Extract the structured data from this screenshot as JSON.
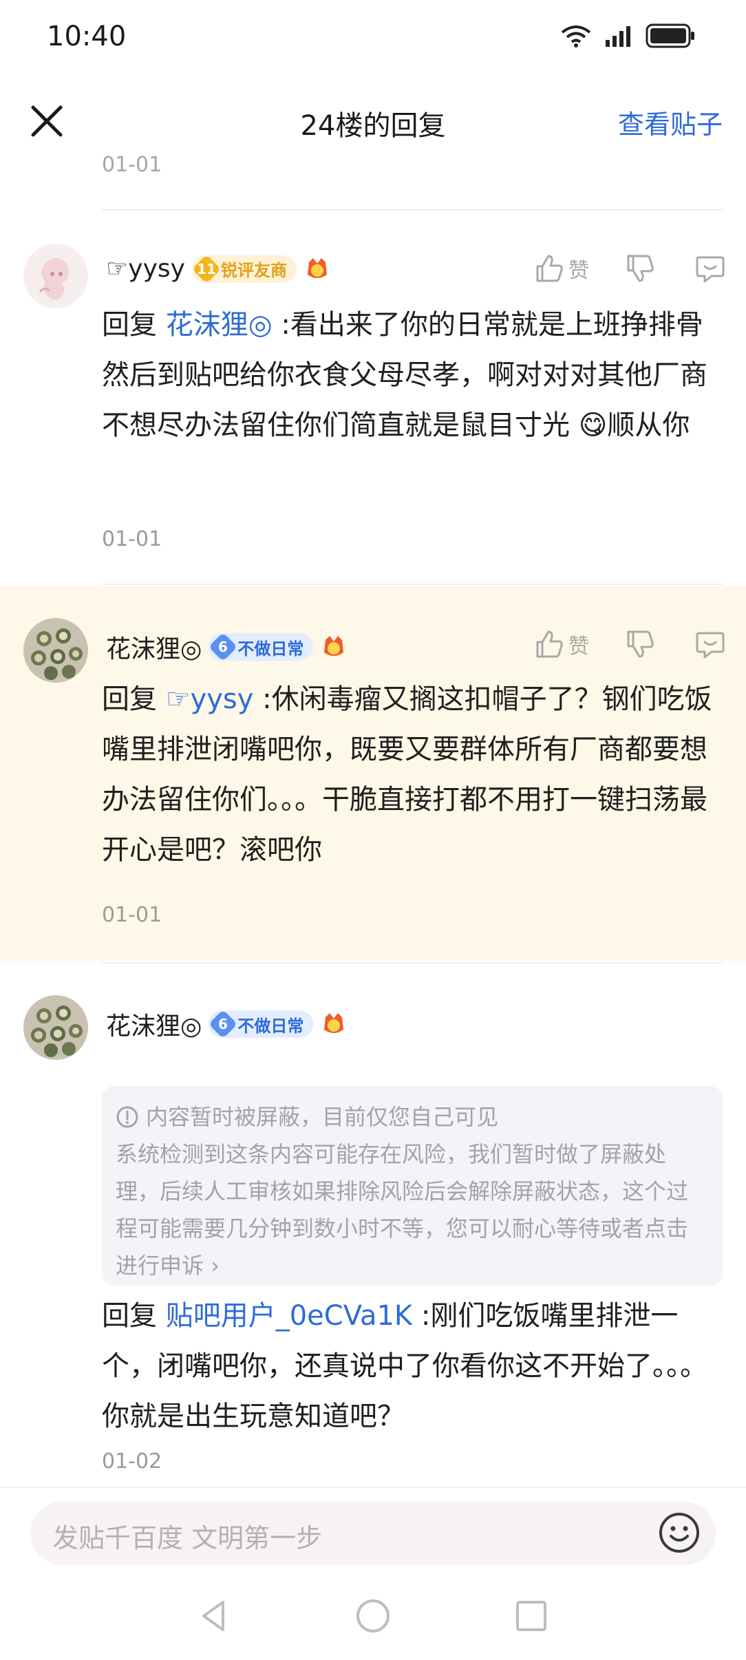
{
  "status_bar": {
    "time": "10:40"
  },
  "header": {
    "title": "24楼的回复",
    "view_post": "查看贴子"
  },
  "previous": {
    "date": "01-01"
  },
  "replies": [
    {
      "username": "☞yysy",
      "badge_level": "11",
      "badge_text": "锐评友商",
      "like_label": "赞",
      "lead": "回复 ",
      "mention": "花沫狸◎",
      "text": " :看出来了你的日常就是上班挣排骨然后到贴吧给你衣食父母尽孝，啊对对对其他厂商不想尽办法留住你们简直就是鼠目寸光 ",
      "emoji": "😋",
      "tail": "顺从你",
      "date": "01-01"
    },
    {
      "username": "花沫狸◎",
      "badge_level": "6",
      "badge_text": "不做日常",
      "like_label": "赞",
      "lead": "回复 ",
      "mention": "☞yysy",
      "text": " :休闲毒瘤又搁这扣帽子了？钢们吃饭嘴里排泄闭嘴吧你，既要又要群体所有厂商都要想办法留住你们。。。干脆直接打都不用打一键扫荡最开心是吧？滚吧你",
      "date": "01-01"
    },
    {
      "username": "花沫狸◎",
      "badge_level": "6",
      "badge_text": "不做日常",
      "blocked_title": "内容暂时被屏蔽，目前仅您自己可见",
      "blocked_body": "系统检测到这条内容可能存在风险，我们暂时做了屏蔽处理，后续人工审核如果排除风险后会解除屏蔽状态，这个过程可能需要几分钟到数小时不等，您可以耐心等待或者点击进行申诉",
      "blocked_link": "›",
      "lead": "回复 ",
      "mention": "贴吧用户_0eCVa1K",
      "text": " :刚们吃饭嘴里排泄一个，闭嘴吧你，还真说中了你看你这不开始了。。。你就是出生玩意知道吧？",
      "date": "01-02"
    }
  ],
  "bottom": {
    "placeholder": "发贴千百度 文明第一步"
  }
}
